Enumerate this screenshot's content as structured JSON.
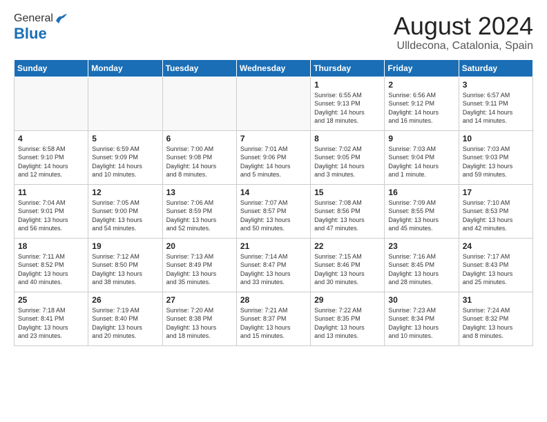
{
  "header": {
    "logo_general": "General",
    "logo_blue": "Blue",
    "month_title": "August 2024",
    "location": "Ulldecona, Catalonia, Spain"
  },
  "days_of_week": [
    "Sunday",
    "Monday",
    "Tuesday",
    "Wednesday",
    "Thursday",
    "Friday",
    "Saturday"
  ],
  "weeks": [
    [
      {
        "num": "",
        "info": ""
      },
      {
        "num": "",
        "info": ""
      },
      {
        "num": "",
        "info": ""
      },
      {
        "num": "",
        "info": ""
      },
      {
        "num": "1",
        "info": "Sunrise: 6:55 AM\nSunset: 9:13 PM\nDaylight: 14 hours\nand 18 minutes."
      },
      {
        "num": "2",
        "info": "Sunrise: 6:56 AM\nSunset: 9:12 PM\nDaylight: 14 hours\nand 16 minutes."
      },
      {
        "num": "3",
        "info": "Sunrise: 6:57 AM\nSunset: 9:11 PM\nDaylight: 14 hours\nand 14 minutes."
      }
    ],
    [
      {
        "num": "4",
        "info": "Sunrise: 6:58 AM\nSunset: 9:10 PM\nDaylight: 14 hours\nand 12 minutes."
      },
      {
        "num": "5",
        "info": "Sunrise: 6:59 AM\nSunset: 9:09 PM\nDaylight: 14 hours\nand 10 minutes."
      },
      {
        "num": "6",
        "info": "Sunrise: 7:00 AM\nSunset: 9:08 PM\nDaylight: 14 hours\nand 8 minutes."
      },
      {
        "num": "7",
        "info": "Sunrise: 7:01 AM\nSunset: 9:06 PM\nDaylight: 14 hours\nand 5 minutes."
      },
      {
        "num": "8",
        "info": "Sunrise: 7:02 AM\nSunset: 9:05 PM\nDaylight: 14 hours\nand 3 minutes."
      },
      {
        "num": "9",
        "info": "Sunrise: 7:03 AM\nSunset: 9:04 PM\nDaylight: 14 hours\nand 1 minute."
      },
      {
        "num": "10",
        "info": "Sunrise: 7:03 AM\nSunset: 9:03 PM\nDaylight: 13 hours\nand 59 minutes."
      }
    ],
    [
      {
        "num": "11",
        "info": "Sunrise: 7:04 AM\nSunset: 9:01 PM\nDaylight: 13 hours\nand 56 minutes."
      },
      {
        "num": "12",
        "info": "Sunrise: 7:05 AM\nSunset: 9:00 PM\nDaylight: 13 hours\nand 54 minutes."
      },
      {
        "num": "13",
        "info": "Sunrise: 7:06 AM\nSunset: 8:59 PM\nDaylight: 13 hours\nand 52 minutes."
      },
      {
        "num": "14",
        "info": "Sunrise: 7:07 AM\nSunset: 8:57 PM\nDaylight: 13 hours\nand 50 minutes."
      },
      {
        "num": "15",
        "info": "Sunrise: 7:08 AM\nSunset: 8:56 PM\nDaylight: 13 hours\nand 47 minutes."
      },
      {
        "num": "16",
        "info": "Sunrise: 7:09 AM\nSunset: 8:55 PM\nDaylight: 13 hours\nand 45 minutes."
      },
      {
        "num": "17",
        "info": "Sunrise: 7:10 AM\nSunset: 8:53 PM\nDaylight: 13 hours\nand 42 minutes."
      }
    ],
    [
      {
        "num": "18",
        "info": "Sunrise: 7:11 AM\nSunset: 8:52 PM\nDaylight: 13 hours\nand 40 minutes."
      },
      {
        "num": "19",
        "info": "Sunrise: 7:12 AM\nSunset: 8:50 PM\nDaylight: 13 hours\nand 38 minutes."
      },
      {
        "num": "20",
        "info": "Sunrise: 7:13 AM\nSunset: 8:49 PM\nDaylight: 13 hours\nand 35 minutes."
      },
      {
        "num": "21",
        "info": "Sunrise: 7:14 AM\nSunset: 8:47 PM\nDaylight: 13 hours\nand 33 minutes."
      },
      {
        "num": "22",
        "info": "Sunrise: 7:15 AM\nSunset: 8:46 PM\nDaylight: 13 hours\nand 30 minutes."
      },
      {
        "num": "23",
        "info": "Sunrise: 7:16 AM\nSunset: 8:45 PM\nDaylight: 13 hours\nand 28 minutes."
      },
      {
        "num": "24",
        "info": "Sunrise: 7:17 AM\nSunset: 8:43 PM\nDaylight: 13 hours\nand 25 minutes."
      }
    ],
    [
      {
        "num": "25",
        "info": "Sunrise: 7:18 AM\nSunset: 8:41 PM\nDaylight: 13 hours\nand 23 minutes."
      },
      {
        "num": "26",
        "info": "Sunrise: 7:19 AM\nSunset: 8:40 PM\nDaylight: 13 hours\nand 20 minutes."
      },
      {
        "num": "27",
        "info": "Sunrise: 7:20 AM\nSunset: 8:38 PM\nDaylight: 13 hours\nand 18 minutes."
      },
      {
        "num": "28",
        "info": "Sunrise: 7:21 AM\nSunset: 8:37 PM\nDaylight: 13 hours\nand 15 minutes."
      },
      {
        "num": "29",
        "info": "Sunrise: 7:22 AM\nSunset: 8:35 PM\nDaylight: 13 hours\nand 13 minutes."
      },
      {
        "num": "30",
        "info": "Sunrise: 7:23 AM\nSunset: 8:34 PM\nDaylight: 13 hours\nand 10 minutes."
      },
      {
        "num": "31",
        "info": "Sunrise: 7:24 AM\nSunset: 8:32 PM\nDaylight: 13 hours\nand 8 minutes."
      }
    ]
  ]
}
